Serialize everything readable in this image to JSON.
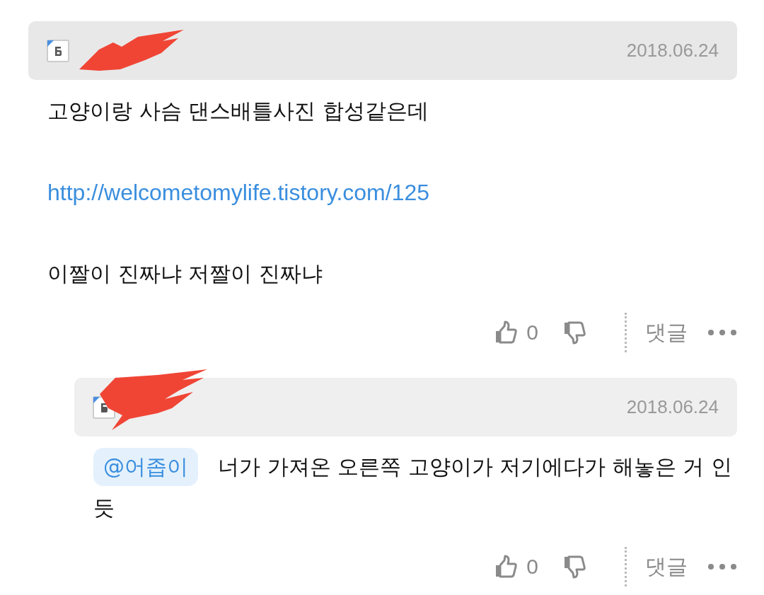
{
  "comments": [
    {
      "date": "2018.06.24",
      "paragraphs": [
        {
          "kind": "text",
          "text": "고양이랑 사슴 댄스배틀사진 합성같은데"
        },
        {
          "kind": "link",
          "text": "http://welcometomylife.tistory.com/125"
        },
        {
          "kind": "text",
          "text": "이짤이 진짜냐 저짤이 진짜냐"
        }
      ],
      "likes": "0",
      "reply_label": "댓글",
      "replies": [
        {
          "date": "2018.06.24",
          "mention": "@어좁이",
          "text": "너가 가져온 오른쪽 고양이가 저기에다가 해놓은 거 인듯",
          "likes": "0",
          "reply_label": "댓글"
        }
      ]
    }
  ]
}
